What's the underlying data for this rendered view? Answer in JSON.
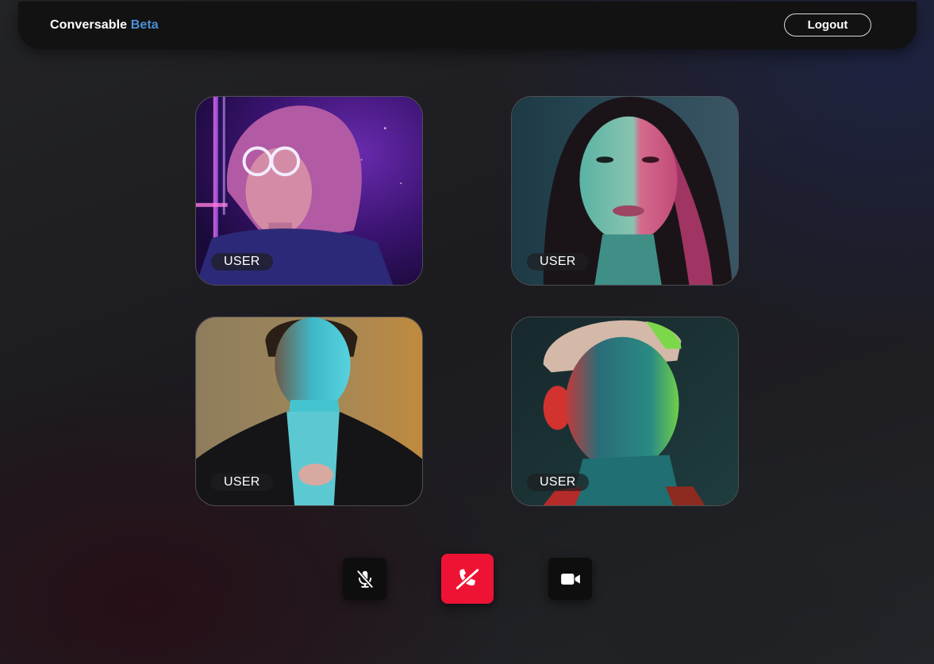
{
  "header": {
    "brand_name": "Conversable",
    "brand_suffix": "Beta",
    "logout_label": "Logout"
  },
  "participants": [
    {
      "label": "USER",
      "icon": "participant-video"
    },
    {
      "label": "USER",
      "icon": "participant-video"
    },
    {
      "label": "USER",
      "icon": "participant-video"
    },
    {
      "label": "USER",
      "icon": "participant-video"
    }
  ],
  "controls": {
    "mic": {
      "icon": "mic-off-icon",
      "state": "muted"
    },
    "end_call": {
      "icon": "end-call-icon",
      "color": "#ee1334"
    },
    "camera": {
      "icon": "video-camera-icon",
      "state": "on"
    }
  },
  "colors": {
    "accent": "#4c8fd6",
    "danger": "#ee1334"
  }
}
